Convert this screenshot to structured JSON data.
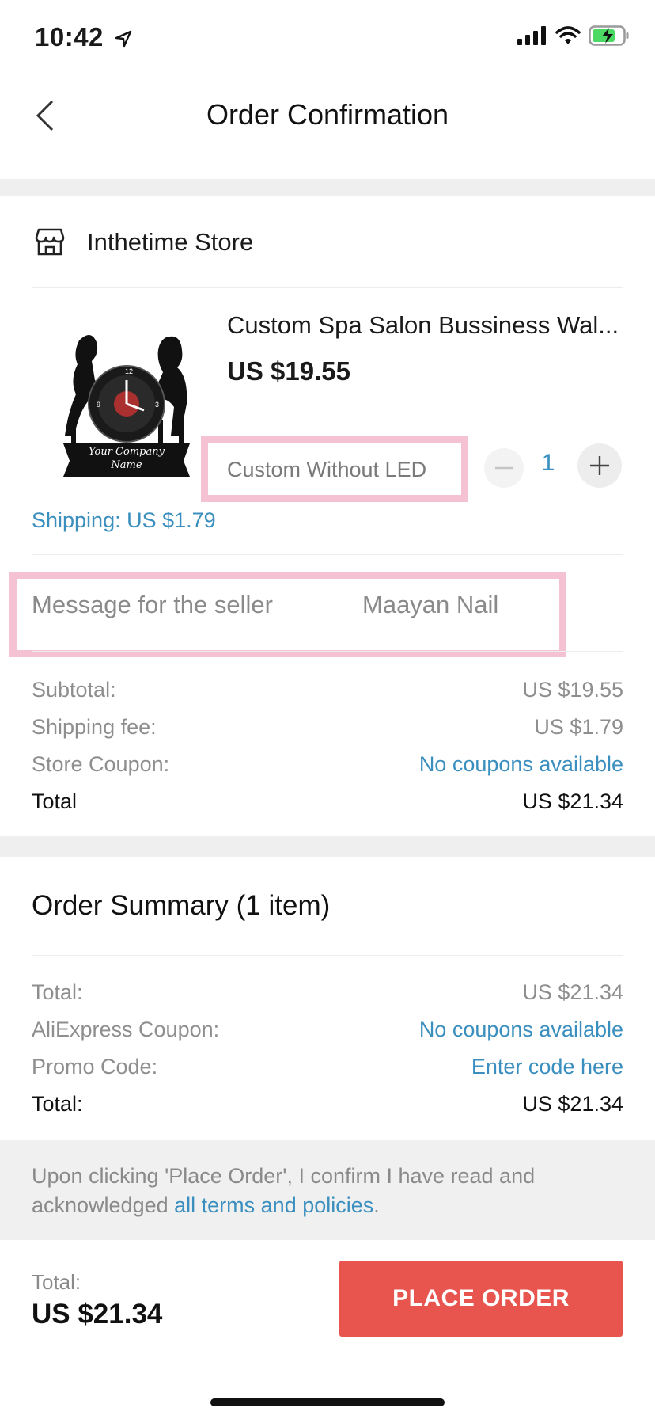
{
  "status_bar": {
    "time": "10:42"
  },
  "nav": {
    "title": "Order Confirmation"
  },
  "store": {
    "name": "Inthetime Store"
  },
  "product": {
    "title": "Custom Spa Salon Bussiness Wal...",
    "price": "US $19.55",
    "variant": "Custom Without LED",
    "quantity": "1",
    "image_text_line1": "Your Company",
    "image_text_line2": "Name",
    "shipping": "Shipping: US $1.79"
  },
  "message": {
    "label": "Message for the seller",
    "value": "Maayan Nail"
  },
  "store_summary": {
    "subtotal_label": "Subtotal:",
    "subtotal_value": "US $19.55",
    "shipping_label": "Shipping fee:",
    "shipping_value": "US $1.79",
    "coupon_label": "Store Coupon:",
    "coupon_value": "No coupons available",
    "total_label": "Total",
    "total_value": "US $21.34"
  },
  "order_summary": {
    "title": "Order Summary (1 item)",
    "total_label": "Total:",
    "total_value": "US $21.34",
    "ali_coupon_label": "AliExpress Coupon:",
    "ali_coupon_value": "No coupons available",
    "promo_label": "Promo Code:",
    "promo_value": "Enter code here",
    "grand_total_label": "Total:",
    "grand_total_value": "US $21.34"
  },
  "terms": {
    "text_before": "Upon clicking 'Place Order', I confirm I have read and acknowledged ",
    "link": "all terms and policies",
    "text_after": "."
  },
  "footer": {
    "total_label": "Total:",
    "total_value": "US $21.34",
    "button_label": "PLACE ORDER"
  },
  "colors": {
    "accent": "#e8554e",
    "link": "#3b8fbf",
    "highlight": "#e978a0"
  }
}
